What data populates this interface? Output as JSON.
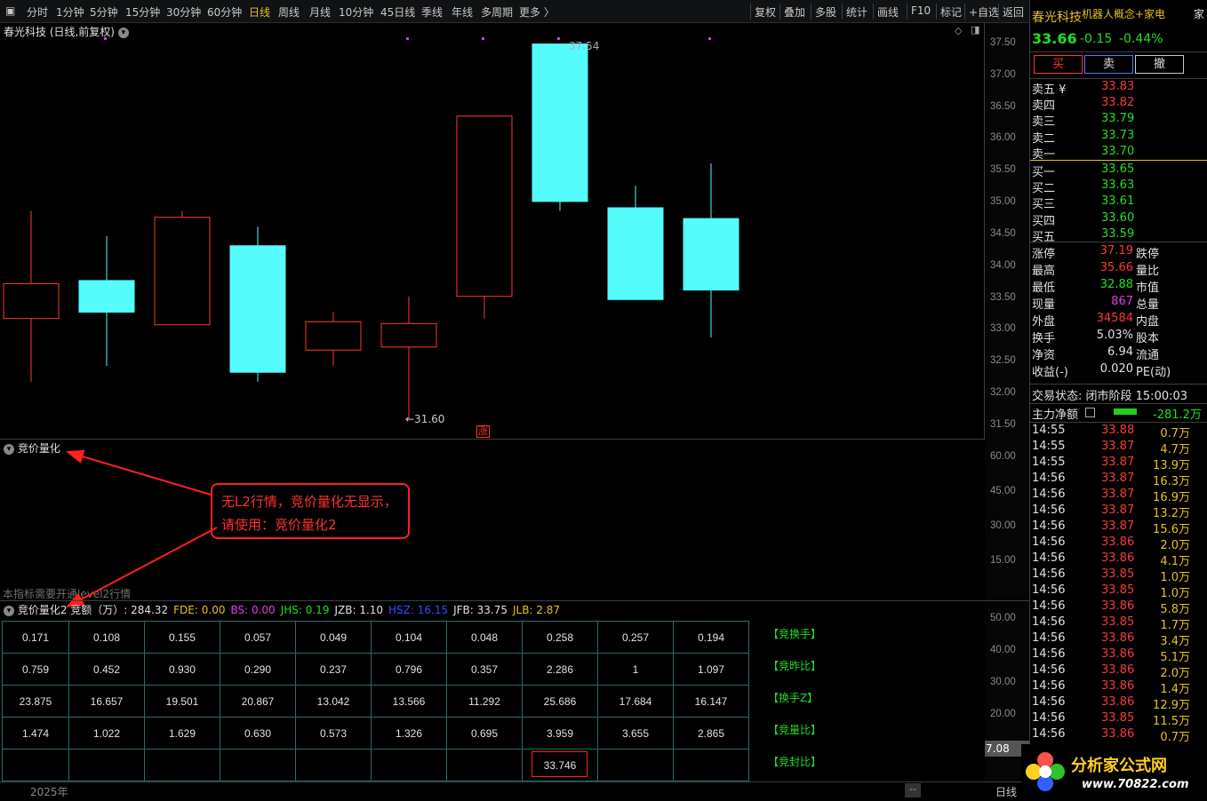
{
  "toolbar": {
    "periods": [
      "分时",
      "1分钟",
      "5分钟",
      "15分钟",
      "30分钟",
      "60分钟",
      "日线",
      "周线",
      "月线",
      "10分钟",
      "45日线",
      "季线",
      "年线",
      "多周期",
      "更多 〉"
    ],
    "active_period": "日线",
    "tools": [
      "复权",
      "叠加",
      "多股",
      "统计",
      "画线",
      "F10",
      "标记",
      "+自选",
      "返回"
    ]
  },
  "chart": {
    "title": "春光科技 (日线,前复权)",
    "high_label": "37.54",
    "low_label": "←31.60",
    "limit_marker": "涨",
    "y_ticks": [
      "37.50",
      "37.00",
      "36.50",
      "36.00",
      "35.50",
      "35.00",
      "34.50",
      "34.00",
      "33.50",
      "33.00",
      "32.50",
      "32.00",
      "31.50"
    ],
    "candles": [
      {
        "open": 33.75,
        "close": 33.2,
        "high": 34.9,
        "low": 32.2,
        "color": "up"
      },
      {
        "open": 33.3,
        "close": 33.8,
        "high": 34.5,
        "low": 32.45,
        "color": "down"
      },
      {
        "open": 33.1,
        "close": 34.8,
        "high": 34.9,
        "low": 33.1,
        "color": "up"
      },
      {
        "open": 34.35,
        "close": 32.35,
        "high": 34.65,
        "low": 32.2,
        "color": "down"
      },
      {
        "open": 32.7,
        "close": 33.15,
        "high": 33.3,
        "low": 32.45,
        "color": "up"
      },
      {
        "open": 32.75,
        "close": 33.12,
        "high": 33.55,
        "low": 31.6,
        "color": "up"
      },
      {
        "open": 33.55,
        "close": 36.4,
        "high": 36.4,
        "low": 33.2,
        "color": "up"
      },
      {
        "open": 37.54,
        "close": 35.05,
        "high": 37.54,
        "low": 34.9,
        "color": "down"
      },
      {
        "open": 33.5,
        "close": 34.95,
        "high": 35.3,
        "low": 33.5,
        "color": "down"
      },
      {
        "open": 33.65,
        "close": 34.78,
        "high": 35.65,
        "low": 32.9,
        "color": "down"
      }
    ]
  },
  "indicator1": {
    "name": "竞价量化",
    "y_ticks": [
      "60.00",
      "45.00",
      "30.00",
      "15.00"
    ],
    "note": "本指标需要开通level2行情",
    "annotation_line1": "无L2行情，竞价量化无显示，",
    "annotation_line2": "请使用：竞价量化2"
  },
  "indicator2": {
    "name": "竞价量化2",
    "summary": [
      {
        "label": "竞额（万）: ",
        "value": "284.32",
        "color": "#e0e0e0"
      },
      {
        "label": "FDE: ",
        "value": "0.00",
        "color": "#e8c020"
      },
      {
        "label": "BS: ",
        "value": "0.00",
        "color": "#e040e0"
      },
      {
        "label": "JHS: ",
        "value": "0.19",
        "color": "#20e020"
      },
      {
        "label": "JZB: ",
        "value": "1.10",
        "color": "#e0e0e0"
      },
      {
        "label": "HSZ: ",
        "value": "16.15",
        "color": "#3050ff"
      },
      {
        "label": "JFB: ",
        "value": "33.75",
        "color": "#e0e0e0"
      },
      {
        "label": "JLB: ",
        "value": "2.87",
        "color": "#e8c020"
      }
    ],
    "y_ticks": [
      "50.00",
      "40.00",
      "30.00",
      "20.00"
    ],
    "last_value": "7.08",
    "rows": [
      [
        "0.171",
        "0.108",
        "0.155",
        "0.057",
        "0.049",
        "0.104",
        "0.048",
        "0.258",
        "0.257",
        "0.194"
      ],
      [
        "0.759",
        "0.452",
        "0.930",
        "0.290",
        "0.237",
        "0.796",
        "0.357",
        "2.286",
        "1",
        "1.097"
      ],
      [
        "23.875",
        "16.657",
        "19.501",
        "20.867",
        "13.042",
        "13.566",
        "11.292",
        "25.686",
        "17.684",
        "16.147"
      ],
      [
        "1.474",
        "1.022",
        "1.629",
        "0.630",
        "0.573",
        "1.326",
        "0.695",
        "3.959",
        "3.655",
        "2.865"
      ],
      [
        "",
        "",
        "",
        "",
        "",
        "",
        "",
        "33.746",
        "",
        ""
      ]
    ],
    "row_labels": [
      "【竞换手】",
      "【竞昨比】",
      "【换手Z】",
      "【竞量比】",
      "【竞封比】"
    ]
  },
  "footer": {
    "year": "2025年",
    "period": "日线"
  },
  "quote": {
    "name": "春光科技",
    "concepts": "机器人概念+家电",
    "extra": "家",
    "price": "33.66",
    "change": "-0.15",
    "change_pct": "-0.44%",
    "buy_label": "买",
    "sell_label": "卖",
    "cancel_label": "撤",
    "asks": [
      {
        "label": "卖五 ¥",
        "price": "33.83",
        "color": "red"
      },
      {
        "label": "卖四",
        "price": "33.82",
        "color": "red"
      },
      {
        "label": "卖三",
        "price": "33.79",
        "color": "green"
      },
      {
        "label": "卖二",
        "price": "33.73",
        "color": "green"
      },
      {
        "label": "卖一",
        "price": "33.70",
        "color": "green"
      }
    ],
    "bids": [
      {
        "label": "买一",
        "price": "33.65",
        "color": "green"
      },
      {
        "label": "买二",
        "price": "33.63",
        "color": "green"
      },
      {
        "label": "买三",
        "price": "33.61",
        "color": "green"
      },
      {
        "label": "买四",
        "price": "33.60",
        "color": "green"
      },
      {
        "label": "买五",
        "price": "33.59",
        "color": "green"
      }
    ],
    "stats": [
      {
        "l1": "涨停",
        "v1": "37.19",
        "c1": "red",
        "l2": "跌停"
      },
      {
        "l1": "最高",
        "v1": "35.66",
        "c1": "red",
        "l2": "量比"
      },
      {
        "l1": "最低",
        "v1": "32.88",
        "c1": "green",
        "l2": "市值"
      },
      {
        "l1": "现量",
        "v1": "867",
        "c1": "magenta",
        "l2": "总量"
      },
      {
        "l1": "外盘",
        "v1": "34584",
        "c1": "red",
        "l2": "内盘"
      },
      {
        "l1": "换手",
        "v1": "5.03%",
        "c1": "white",
        "l2": "股本"
      },
      {
        "l1": "净资",
        "v1": "6.94",
        "c1": "white",
        "l2": "流通"
      },
      {
        "l1": "收益(-)",
        "v1": "0.020",
        "c1": "white",
        "l2": "PE(动)"
      }
    ],
    "trade_status": "交易状态: 闭市阶段 15:00:03",
    "net_flow_label": "主力净额",
    "net_flow_value": "-281.2万"
  },
  "ticks": [
    {
      "time": "14:55",
      "price": "33.88",
      "vol": "0.7万"
    },
    {
      "time": "14:55",
      "price": "33.87",
      "vol": "4.7万"
    },
    {
      "time": "14:55",
      "price": "33.87",
      "vol": "13.9万"
    },
    {
      "time": "14:56",
      "price": "33.87",
      "vol": "16.3万"
    },
    {
      "time": "14:56",
      "price": "33.87",
      "vol": "16.9万"
    },
    {
      "time": "14:56",
      "price": "33.87",
      "vol": "13.2万"
    },
    {
      "time": "14:56",
      "price": "33.87",
      "vol": "15.6万"
    },
    {
      "time": "14:56",
      "price": "33.86",
      "vol": "2.0万"
    },
    {
      "time": "14:56",
      "price": "33.86",
      "vol": "4.1万"
    },
    {
      "time": "14:56",
      "price": "33.85",
      "vol": "1.0万"
    },
    {
      "time": "14:56",
      "price": "33.85",
      "vol": "1.0万"
    },
    {
      "time": "14:56",
      "price": "33.86",
      "vol": "5.8万"
    },
    {
      "time": "14:56",
      "price": "33.85",
      "vol": "1.7万"
    },
    {
      "time": "14:56",
      "price": "33.86",
      "vol": "3.4万"
    },
    {
      "time": "14:56",
      "price": "33.86",
      "vol": "5.1万"
    },
    {
      "time": "14:56",
      "price": "33.86",
      "vol": "2.0万"
    },
    {
      "time": "14:56",
      "price": "33.86",
      "vol": "1.4万"
    },
    {
      "time": "14:56",
      "price": "33.86",
      "vol": "12.9万"
    },
    {
      "time": "14:56",
      "price": "33.85",
      "vol": "11.5万"
    },
    {
      "time": "14:56",
      "price": "33.86",
      "vol": "0.7万"
    }
  ],
  "logo": {
    "text": "分析家公式网",
    "url_text": "www.70822.com"
  },
  "colors": {
    "up": "#ff3838",
    "down": "#54fcfc",
    "grid": "#3a3e44"
  }
}
